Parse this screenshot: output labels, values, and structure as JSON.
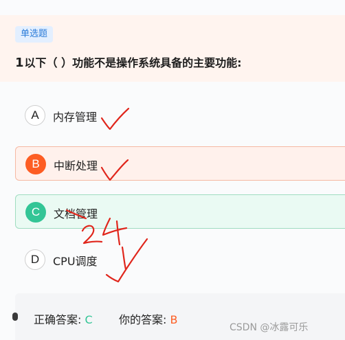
{
  "question": {
    "type_tag": "单选题",
    "number": "1",
    "text": "以下（ ）功能不是操作系统具备的主要功能:"
  },
  "options": [
    {
      "letter": "A",
      "text": "内存管理",
      "state": "normal"
    },
    {
      "letter": "B",
      "text": "中断处理",
      "state": "selected-wrong"
    },
    {
      "letter": "C",
      "text": "文档管理",
      "state": "correct"
    },
    {
      "letter": "D",
      "text": "CPU调度",
      "state": "normal"
    }
  ],
  "result": {
    "correct_label": "正确答案:",
    "correct_value": "C",
    "your_label": "你的答案:",
    "your_value": "B"
  },
  "annotation": {
    "color": "#e0261c"
  },
  "watermark": "CSDN @冰露可乐",
  "colors": {
    "wrong": "#fd5d23",
    "correct": "#33c596",
    "tag": "#2a7bd8"
  }
}
